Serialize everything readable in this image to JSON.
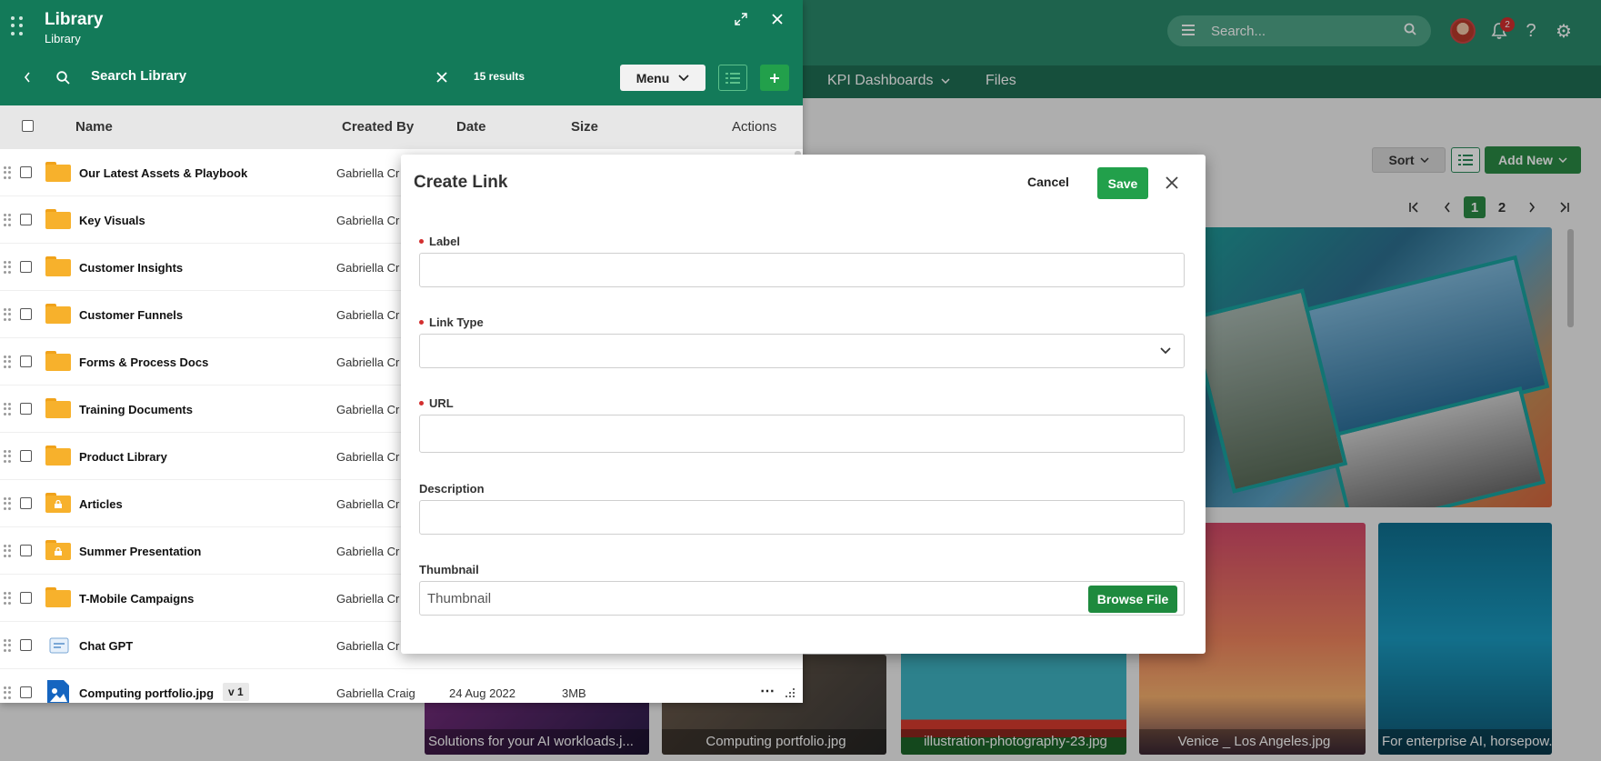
{
  "app": {
    "search_placeholder": "Search...",
    "notification_count": "2",
    "nav": [
      {
        "label": "KPI Dashboards"
      },
      {
        "label": "Files"
      }
    ],
    "sort_label": "Sort",
    "add_new_label": "Add New",
    "pagination": {
      "pages": [
        "1",
        "2"
      ],
      "current": "1"
    },
    "tiles": [
      {
        "caption": "Solutions for your AI workloads.j..."
      },
      {
        "caption": "Computing portfolio.jpg"
      },
      {
        "caption": "illustration-photography-23.jpg"
      },
      {
        "caption": "Venice _ Los Angeles.jpg"
      },
      {
        "caption": "For enterprise AI, horsepow..."
      }
    ]
  },
  "library": {
    "title": "Library",
    "subtitle": "Library",
    "search_placeholder": "Search Library",
    "results": "15 results",
    "menu_label": "Menu",
    "columns": {
      "name": "Name",
      "created_by": "Created By",
      "date": "Date",
      "size": "Size",
      "actions": "Actions"
    },
    "rows": [
      {
        "name": "Our Latest Assets & Playbook",
        "created_by": "Gabriella Cr",
        "type": "folder"
      },
      {
        "name": "Key Visuals",
        "created_by": "Gabriella Cr",
        "type": "folder"
      },
      {
        "name": "Customer Insights",
        "created_by": "Gabriella Cr",
        "type": "folder"
      },
      {
        "name": "Customer Funnels",
        "created_by": "Gabriella Cr",
        "type": "folder"
      },
      {
        "name": "Forms & Process Docs",
        "created_by": "Gabriella Cr",
        "type": "folder"
      },
      {
        "name": "Training Documents",
        "created_by": "Gabriella Cr",
        "type": "folder"
      },
      {
        "name": "Product Library",
        "created_by": "Gabriella Cr",
        "type": "folder"
      },
      {
        "name": "Articles",
        "created_by": "Gabriella Cr",
        "type": "locked-folder"
      },
      {
        "name": "Summer Presentation",
        "created_by": "Gabriella Cr",
        "type": "locked-folder"
      },
      {
        "name": "T-Mobile Campaigns",
        "created_by": "Gabriella Cr",
        "type": "folder"
      },
      {
        "name": "Chat GPT",
        "created_by": "Gabriella Cr",
        "type": "link"
      },
      {
        "name": "Computing portfolio.jpg",
        "version": "v 1",
        "created_by": "Gabriella Craig",
        "date": "24 Aug 2022",
        "size": "3MB",
        "type": "image"
      }
    ]
  },
  "modal": {
    "title": "Create Link",
    "cancel_label": "Cancel",
    "save_label": "Save",
    "fields": {
      "label": {
        "label": "Label",
        "value": ""
      },
      "link_type": {
        "label": "Link Type",
        "value": ""
      },
      "url": {
        "label": "URL",
        "value": ""
      },
      "description": {
        "label": "Description",
        "value": ""
      },
      "thumbnail": {
        "label": "Thumbnail",
        "placeholder": "Thumbnail",
        "button": "Browse File"
      }
    }
  },
  "colors": {
    "header_green": "#137a59",
    "topbar_green": "#2a8a6b",
    "button_green": "#22a04b",
    "folder_orange": "#f7b12c",
    "required_red": "#d32f2f"
  }
}
